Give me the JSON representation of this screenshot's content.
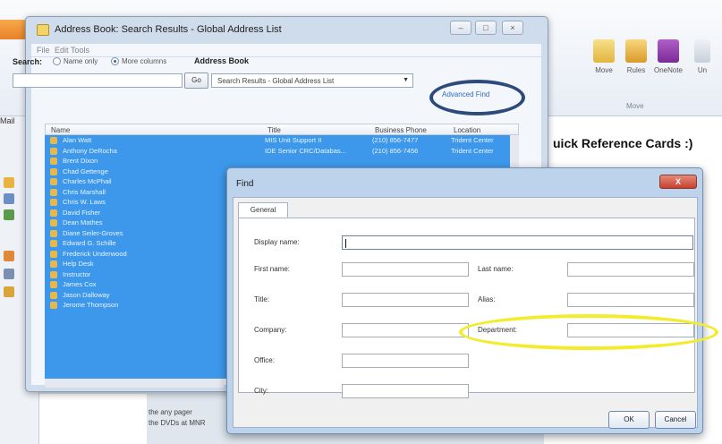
{
  "outlook": {
    "ribbon": {
      "move_label": "Move",
      "rules_label": "Rules",
      "onenote_label": "OneNote",
      "unread_label": "Un",
      "group_label": "Move"
    },
    "doc_title": "uick Reference Cards :)",
    "doc_text_1": "the any pager",
    "doc_text_2": "the DVDs at MNR",
    "nav_label": "Mail"
  },
  "address_book": {
    "title": "Address Book: Search Results - Global Address List",
    "menu": [
      "File",
      "Edit",
      "Tools"
    ],
    "search_label": "Search:",
    "option_name_only": "Name only",
    "option_more_columns": "More columns",
    "address_book_label": "Address Book",
    "go_label": "Go",
    "book_value": "Search Results - Global Address List",
    "advanced_find": "Advanced Find",
    "columns": {
      "name": "Name",
      "title": "Title",
      "phone": "Business Phone",
      "location": "Location"
    },
    "rows": [
      {
        "name": "Alan Watt",
        "title": "MIS Unit Support II",
        "phone": "(210) 856-7477",
        "location": "Trident Center"
      },
      {
        "name": "Anthony DeRocha",
        "title": "IDE Senior CRC/Databas...",
        "phone": "(210) 856-7456",
        "location": "Trident Center"
      },
      {
        "name": "Brent Dixon",
        "title": "",
        "phone": "",
        "location": ""
      },
      {
        "name": "Chad Gettenge",
        "title": "",
        "phone": "",
        "location": ""
      },
      {
        "name": "Charles McPhail",
        "title": "",
        "phone": "",
        "location": ""
      },
      {
        "name": "Chris Marshall",
        "title": "",
        "phone": "",
        "location": ""
      },
      {
        "name": "Chris W. Laws",
        "title": "",
        "phone": "",
        "location": ""
      },
      {
        "name": "David Fisher",
        "title": "",
        "phone": "",
        "location": ""
      },
      {
        "name": "Dean Mathes",
        "title": "",
        "phone": "",
        "location": ""
      },
      {
        "name": "Diane Seiler-Groves",
        "title": "",
        "phone": "",
        "location": ""
      },
      {
        "name": "Edward G. Schille",
        "title": "",
        "phone": "",
        "location": ""
      },
      {
        "name": "Frederick Underwood",
        "title": "",
        "phone": "",
        "location": ""
      },
      {
        "name": "Help Desk",
        "title": "",
        "phone": "",
        "location": ""
      },
      {
        "name": "Instructor",
        "title": "",
        "phone": "",
        "location": ""
      },
      {
        "name": "James Cox",
        "title": "",
        "phone": "",
        "location": ""
      },
      {
        "name": "Jason Dalloway",
        "title": "",
        "phone": "",
        "location": ""
      },
      {
        "name": "Jerome Thompson",
        "title": "",
        "phone": "",
        "location": ""
      }
    ]
  },
  "find_dialog": {
    "title": "Find",
    "close_label": "X",
    "tab_general": "General",
    "fields": {
      "display_name": {
        "label": "Display name:",
        "value": ""
      },
      "first_name": {
        "label": "First name:",
        "value": ""
      },
      "last_name": {
        "label": "Last name:",
        "value": ""
      },
      "title": {
        "label": "Title:",
        "value": ""
      },
      "alias": {
        "label": "Alias:",
        "value": ""
      },
      "company": {
        "label": "Company:",
        "value": ""
      },
      "department": {
        "label": "Department:",
        "value": ""
      },
      "office": {
        "label": "Office:",
        "value": ""
      },
      "city": {
        "label": "City:",
        "value": ""
      }
    },
    "ok_label": "OK",
    "cancel_label": "Cancel"
  },
  "annotations": {
    "advanced_find_circle_color": "#2d4a7c",
    "department_circle_color": "#f3ec2c"
  }
}
